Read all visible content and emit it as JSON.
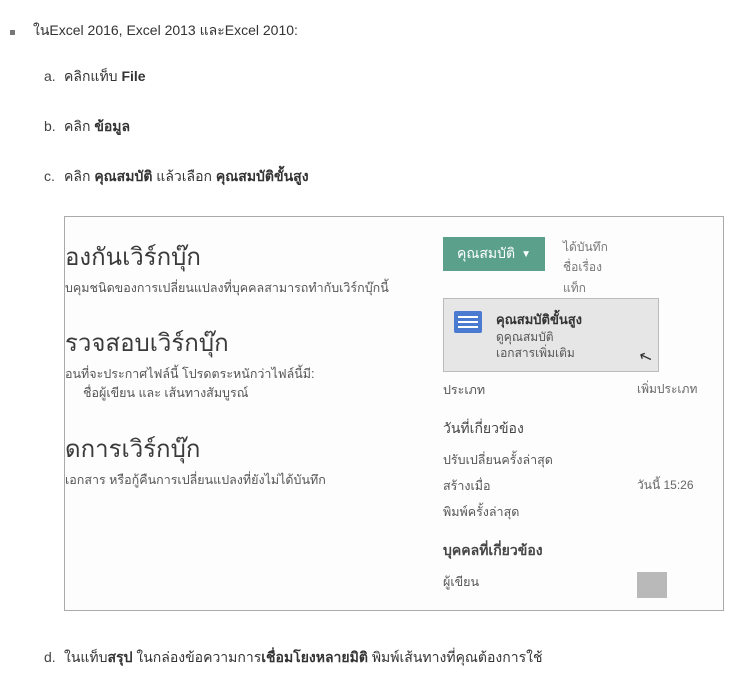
{
  "intro": {
    "prefix": "ใน",
    "versions": "Excel 2016, Excel 2013 ",
    "and": "และ",
    "last": "Excel 2010:"
  },
  "steps": {
    "a_marker": "a.",
    "a_pre": "คลิกแท็บ ",
    "a_bold": "File",
    "b_marker": "b.",
    "b_pre": "คลิก ",
    "b_bold": "ข้อมูล",
    "c_marker": "c.",
    "c_pre": "คลิก ",
    "c_bold1": "คุณสมบัติ",
    "c_mid": " แล้วเลือก ",
    "c_bold2": "คุณสมบัติขั้นสูง",
    "d_marker": "d.",
    "d_p1": "ในแท็บ",
    "d_b1": "สรุป",
    "d_p2": " ในกล่องข้อความการ",
    "d_b2": "เชื่อมโยงหลายมิติ",
    "d_p3": " พิมพ์เส้นทางที่คุณต้องการใช้"
  },
  "excel": {
    "protect": {
      "title": "องกันเวิร์กบุ๊ก",
      "sub": "บคุมชนิดของการเปลี่ยนแปลงที่บุคคลสามารถทำกับเวิร์กบุ๊กนี้"
    },
    "inspect": {
      "title": "รวจสอบเวิร์กบุ๊ก",
      "sub": "อนที่จะประกาศไฟล์นี้ โปรดตระหนักว่าไฟล์นี้มี:",
      "item": "ชื่อผู้เขียน และ เส้นทางสัมบูรณ์"
    },
    "manage": {
      "title": "ดการเวิร์กบุ๊ก",
      "sub": "เอกสาร หรือกู้คืนการเปลี่ยนแปลงที่ยังไม่ได้บันทึก"
    },
    "propBtn": "คุณสมบัติ",
    "dropdown": {
      "title": "คุณสมบัติขั้นสูง",
      "line1": "ดูคุณสมบัติ",
      "line2": "เอกสารเพิ่มเติม"
    },
    "side": {
      "r1": "ได้บันทึก",
      "r2": "ชื่อเรื่อง",
      "r3": "แท็ก",
      "category_label": "ประเภท",
      "category_val": "เพิ่มประเภท"
    },
    "dates": {
      "head": "วันที่เกี่ยวข้อง",
      "modified": "ปรับเปลี่ยนครั้งล่าสุด",
      "created": "สร้างเมื่อ",
      "created_val": "วันนี้ 15:26",
      "printed": "พิมพ์ครั้งล่าสุด"
    },
    "people": {
      "head": "บุคคลที่เกี่ยวข้อง",
      "author": "ผู้เขียน"
    }
  }
}
